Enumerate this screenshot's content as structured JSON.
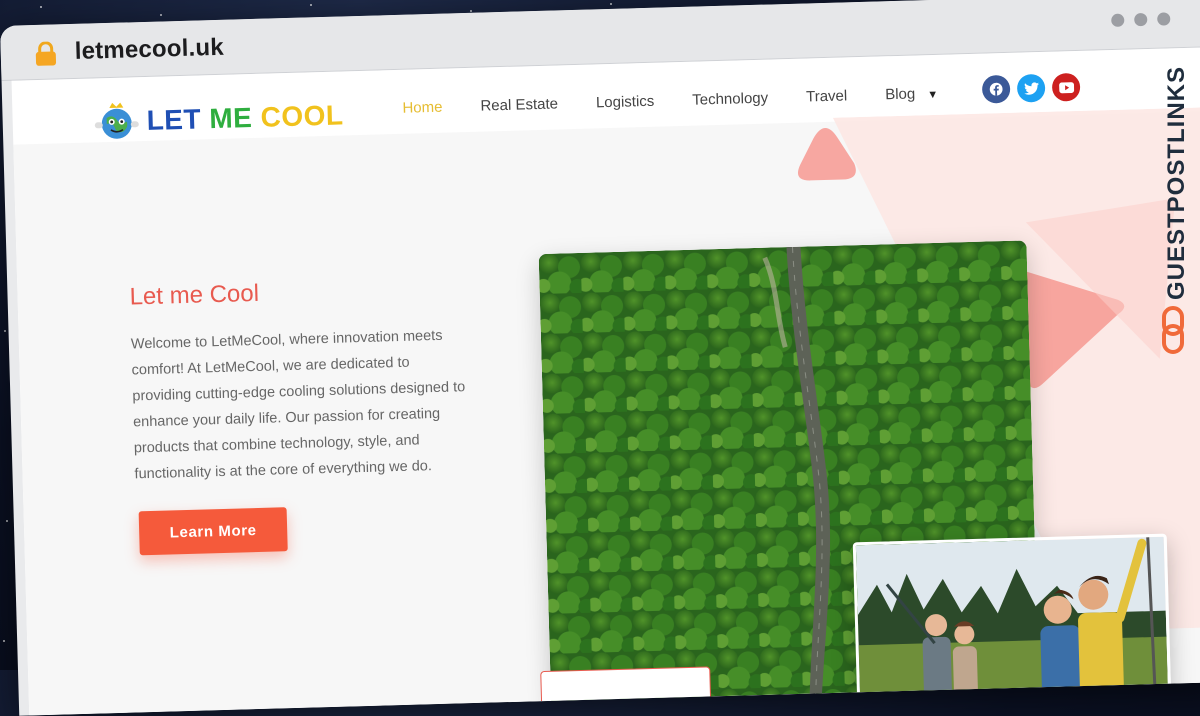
{
  "browser": {
    "url": "letmecool.uk"
  },
  "site": {
    "logo": {
      "word1": "LET",
      "word2": "ME",
      "word3": "COOL"
    },
    "nav": [
      {
        "label": "Home"
      },
      {
        "label": "Real Estate"
      },
      {
        "label": "Logistics"
      },
      {
        "label": "Technology"
      },
      {
        "label": "Travel"
      },
      {
        "label": "Blog"
      }
    ],
    "social_icons": [
      "facebook-icon",
      "twitter-icon",
      "youtube-icon"
    ]
  },
  "hero": {
    "title": "Let me Cool",
    "text": "Welcome to LetMeCool, where innovation meets comfort! At LetMeCool, we are dedicated to providing cutting-edge cooling solutions designed to enhance your daily life. Our passion for creating products that combine technology, style, and functionality is at the core of everything we do.",
    "button": "Learn More"
  },
  "watermark": {
    "text": "GUESTPOSTLINKS"
  },
  "colors": {
    "accent": "#f55a3b",
    "title": "#e85a4f",
    "nav_active": "#e6bd32",
    "logo_blue": "#1f4fb4",
    "logo_green": "#2fae3f",
    "logo_yellow": "#f1c21d"
  }
}
